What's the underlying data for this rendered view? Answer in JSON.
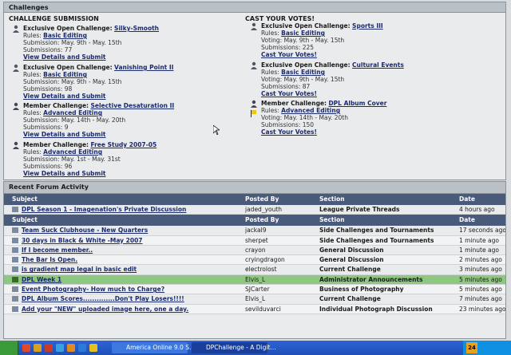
{
  "panel_title": "Challenges",
  "challenge_submission": {
    "heading": "CHALLENGE SUBMISSION",
    "items": [
      {
        "type_label": "Exclusive Open Challenge:",
        "name": "Silky-Smooth",
        "rules_label": "Rules:",
        "rules": "Basic Editing",
        "dates": "Submission: May. 9th - May. 15th",
        "count": "Submissions: 77",
        "details": "View Details and Submit"
      },
      {
        "type_label": "Exclusive Open Challenge:",
        "name": "Vanishing Point II",
        "rules_label": "Rules:",
        "rules": "Basic Editing",
        "dates": "Submission: May. 9th - May. 15th",
        "count": "Submissions: 98",
        "details": "View Details and Submit"
      },
      {
        "type_label": "Member Challenge:",
        "name": "Selective Desaturation II",
        "rules_label": "Rules:",
        "rules": "Advanced Editing",
        "dates": "Submission: May. 14th - May. 20th",
        "count": "Submissions: 9",
        "details": "View Details and Submit"
      },
      {
        "type_label": "Member Challenge:",
        "name": "Free Study 2007-05",
        "rules_label": "Rules:",
        "rules": "Advanced Editing",
        "dates": "Submission: May. 1st - May. 31st",
        "count": "Submissions: 96",
        "details": "View Details and Submit"
      }
    ]
  },
  "cast_votes": {
    "heading": "CAST YOUR VOTES!",
    "items": [
      {
        "type_label": "Exclusive Open Challenge:",
        "name": "Sports III",
        "rules_label": "Rules:",
        "rules": "Basic Editing",
        "dates": "Voting: May. 9th - May. 15th",
        "count": "Submissions: 225",
        "details": "Cast Your Votes!"
      },
      {
        "type_label": "Exclusive Open Challenge:",
        "name": "Cultural Events",
        "rules_label": "Rules:",
        "rules": "Basic Editing",
        "dates": "Voting: May. 9th - May. 15th",
        "count": "Submissions: 87",
        "details": "Cast Your Votes!"
      },
      {
        "type_label": "Member Challenge:",
        "name": "DPL Album Cover",
        "rules_label": "Rules:",
        "rules": "Advanced Editing",
        "dates": "Voting: May. 14th - May. 20th",
        "count": "Submissions: 150",
        "details": "Cast Your Votes!"
      }
    ]
  },
  "forum": {
    "title": "Recent Forum Activity",
    "headers": {
      "subject": "Subject",
      "posted_by": "Posted By",
      "section": "Section",
      "date": "Date"
    },
    "private_rows": [
      {
        "subject": "DPL Season 1 - Imagenation's Private Discussion",
        "posted_by": "jaded_youth",
        "section": "League Private Threads",
        "date": "4 hours ago"
      }
    ],
    "rows": [
      {
        "subject": "Team Suck Clubhouse - New Quarters",
        "posted_by": "jackal9",
        "section": "Side Challenges and Tournaments",
        "date": "17 seconds ago"
      },
      {
        "subject": "30 days in Black & White -May 2007",
        "posted_by": "sherpet",
        "section": "Side Challenges and Tournaments",
        "date": "1 minute ago"
      },
      {
        "subject": "If I become member..",
        "posted_by": "crayon",
        "section": "General Discussion",
        "date": "1 minute ago"
      },
      {
        "subject": "The Bar Is Open.",
        "posted_by": "cryingdragon",
        "section": "General Discussion",
        "date": "2 minutes ago"
      },
      {
        "subject": "is gradient map legal in basic edit",
        "posted_by": "electrolost",
        "section": "Current Challenge",
        "date": "3 minutes ago"
      },
      {
        "subject": "DPL Week 1",
        "posted_by": "Elvis_L",
        "section": "Administrator Announcements",
        "date": "5 minutes ago",
        "highlight": true
      },
      {
        "subject": "Event Photography- How much to Charge?",
        "posted_by": "SJCarter",
        "section": "Business of Photography",
        "date": "5 minutes ago"
      },
      {
        "subject": "DPL Album Scores..............Don't Play Losers!!!!",
        "posted_by": "Elvis_L",
        "section": "Current Challenge",
        "date": "7 minutes ago"
      },
      {
        "subject": "Add your \"NEW\" uploaded image here, one a day.",
        "posted_by": "sevilduvarci",
        "section": "Individual Photograph Discussion",
        "date": "23 minutes ago"
      }
    ]
  },
  "taskbar": {
    "tasks": [
      "America Online 9.0 S...",
      "DPChallenge - A Digit..."
    ],
    "tray_text": "24"
  },
  "colors": {
    "link": "#1c2a6e",
    "header_bar": "#4a5a7a",
    "highlight_row": "#8ec880"
  }
}
